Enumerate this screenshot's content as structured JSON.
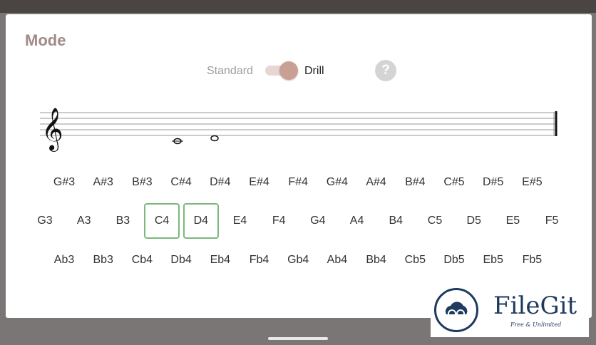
{
  "dialog": {
    "title": "Mode"
  },
  "mode": {
    "standard_label": "Standard",
    "drill_label": "Drill",
    "toggle_on": true,
    "help_label": "?"
  },
  "staff": {
    "clef_glyph": "𝄞",
    "notes_shown": [
      "C4",
      "D4"
    ]
  },
  "notes": {
    "sharps": [
      "G#3",
      "A#3",
      "B#3",
      "C#4",
      "D#4",
      "E#4",
      "F#4",
      "G#4",
      "A#4",
      "B#4",
      "C#5",
      "D#5",
      "E#5"
    ],
    "naturals": [
      "G3",
      "A3",
      "B3",
      "C4",
      "D4",
      "E4",
      "F4",
      "G4",
      "A4",
      "B4",
      "C5",
      "D5",
      "E5",
      "F5"
    ],
    "flats": [
      "Ab3",
      "Bb3",
      "Cb4",
      "Db4",
      "Eb4",
      "Fb4",
      "Gb4",
      "Ab4",
      "Bb4",
      "Cb5",
      "Db5",
      "Eb5",
      "Fb5"
    ],
    "selected": [
      "C4",
      "D4"
    ]
  },
  "watermark": {
    "name": "FileGit",
    "tagline": "Free & Unlimited"
  },
  "colors": {
    "accent": "#c9a094",
    "selected_border": "#7cb87c",
    "title": "#a08a85"
  }
}
